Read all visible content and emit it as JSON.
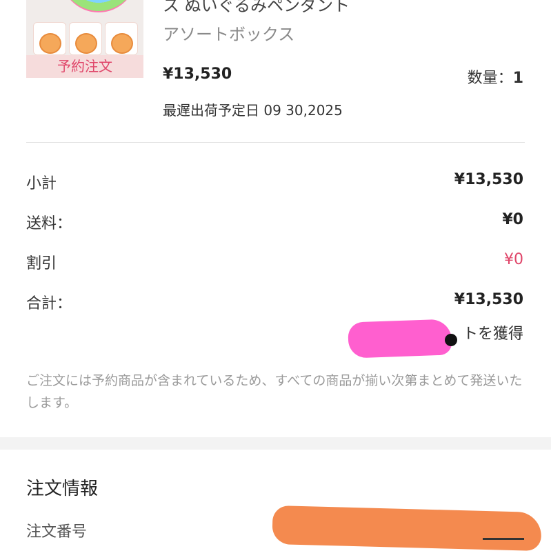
{
  "product": {
    "title_partial": "ス ぬいぐるみペンダント",
    "variant": "アソートボックス",
    "badge": "予約注文",
    "price": "¥13,530",
    "quantity_label": "数量：",
    "quantity": "1",
    "ship_date_label": "最遅出荷予定日 09 30,2025"
  },
  "summary": {
    "rows": [
      {
        "label": "小計",
        "value": "¥13,530"
      },
      {
        "label": "送料：",
        "value": "¥0"
      },
      {
        "label": "割引",
        "value": "¥0"
      },
      {
        "label": "合計：",
        "value": "¥13,530"
      }
    ],
    "points_text": "トを獲得"
  },
  "notice": "ご注文には予約商品が含まれているため、すべての商品が揃い次第まとめて発送いたします。",
  "order_info": {
    "title": "注文情報",
    "order_number_label": "注文番号"
  },
  "colors": {
    "accent_pink": "#e0466a",
    "redaction_pink": "#ff5fcf",
    "redaction_orange": "#f48a4f"
  }
}
